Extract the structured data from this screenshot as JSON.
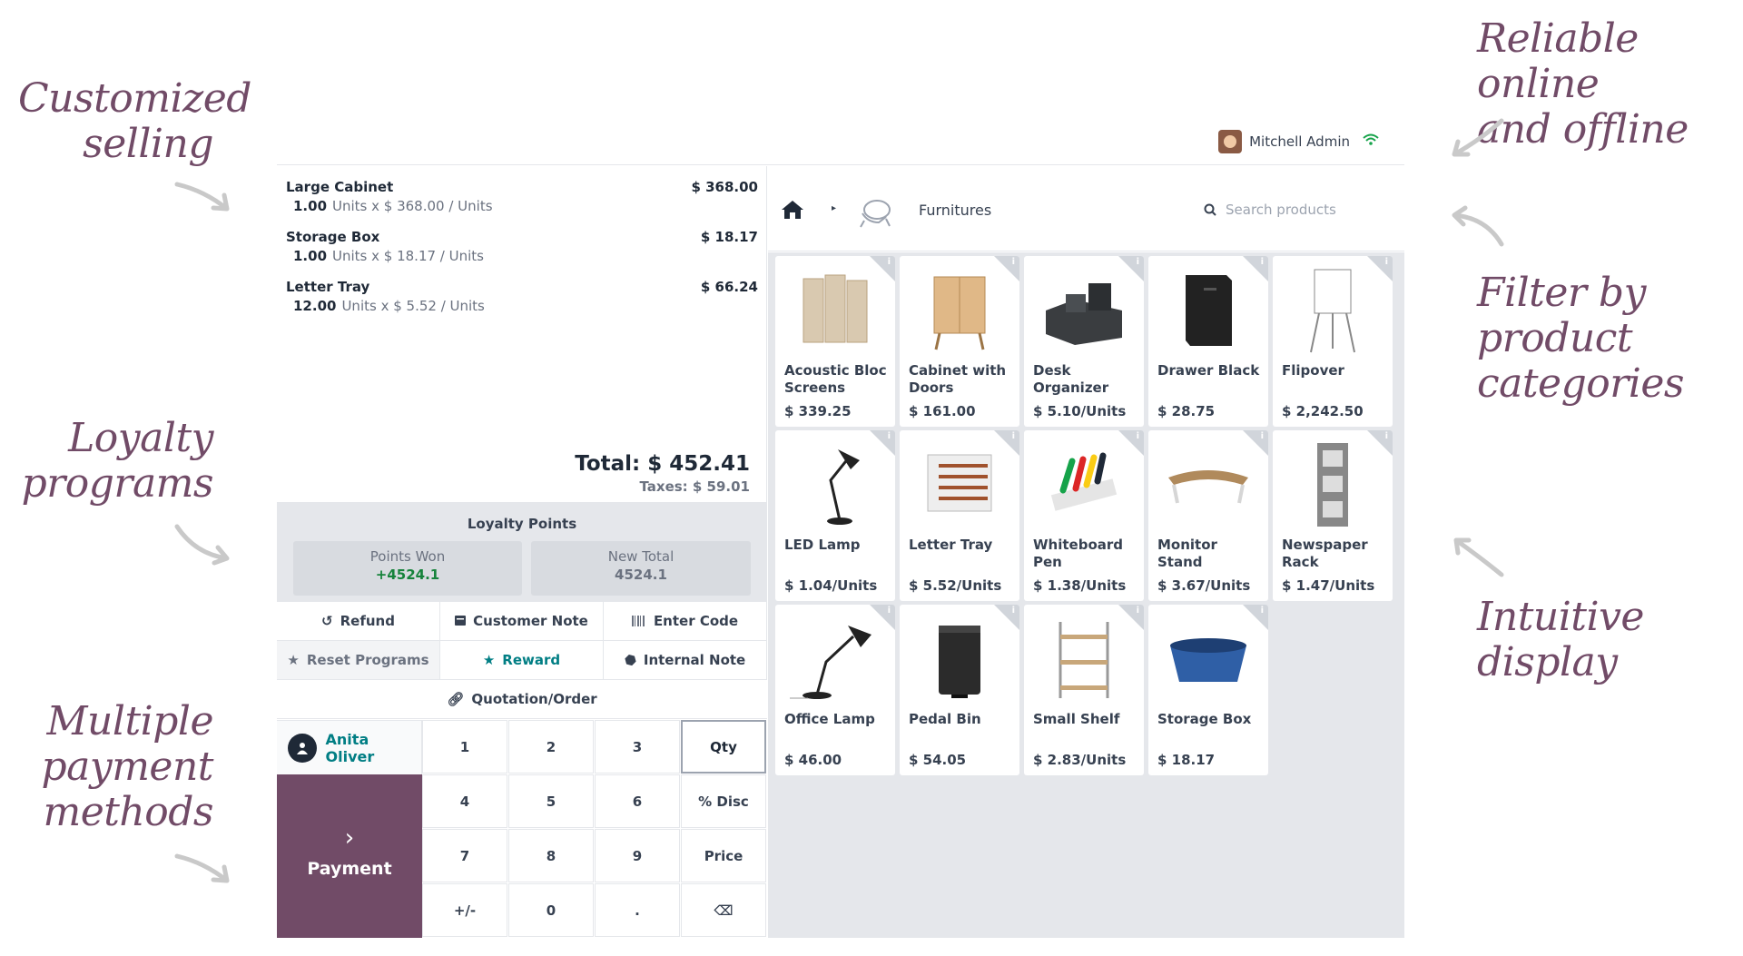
{
  "annotations": {
    "customized_selling": "Customized\nselling",
    "loyalty_programs": "Loyalty\nprograms",
    "multiple_payment": "Multiple\npayment\nmethods",
    "reliable": "Reliable online\nand offline",
    "filter": "Filter by\nproduct\ncategories",
    "intuitive": "Intuitive\ndisplay"
  },
  "topbar": {
    "user_name": "Mitchell Admin"
  },
  "order": {
    "lines": [
      {
        "name": "Large Cabinet",
        "qty": "1.00",
        "detail": "Units x $ 368.00 / Units",
        "price": "$ 368.00"
      },
      {
        "name": "Storage Box",
        "qty": "1.00",
        "detail": "Units x $ 18.17 / Units",
        "price": "$ 18.17"
      },
      {
        "name": "Letter Tray",
        "qty": "12.00",
        "detail": "Units x $ 5.52 / Units",
        "price": "$ 66.24"
      }
    ],
    "total": "Total: $ 452.41",
    "taxes": "Taxes: $ 59.01"
  },
  "loyalty": {
    "title": "Loyalty Points",
    "points_won_label": "Points Won",
    "points_won_value": "+4524.1",
    "new_total_label": "New Total",
    "new_total_value": "4524.1"
  },
  "controls": {
    "refund": "Refund",
    "customer_note": "Customer Note",
    "enter_code": "Enter Code",
    "reset_programs": "Reset Programs",
    "reward": "Reward",
    "internal_note": "Internal Note",
    "quotation": "Quotation/Order"
  },
  "customer": {
    "name": "Anita Oliver"
  },
  "payment": {
    "label": "Payment",
    "chevron": "›"
  },
  "numpad": {
    "keys": [
      "1",
      "2",
      "3",
      "Qty",
      "4",
      "5",
      "6",
      "% Disc",
      "7",
      "8",
      "9",
      "Price",
      "+/-",
      "0",
      ".",
      "⌫"
    ],
    "selected": "Qty"
  },
  "category": {
    "name": "Furnitures",
    "separator": "▸"
  },
  "search": {
    "placeholder": "Search products"
  },
  "products": [
    {
      "name": "Acoustic Bloc Screens",
      "price": "$ 339.25",
      "icon": "acoustic-screen-image"
    },
    {
      "name": "Cabinet with Doors",
      "price": "$ 161.00",
      "icon": "cabinet-image"
    },
    {
      "name": "Desk Organizer",
      "price": "$ 5.10/Units",
      "icon": "desk-organizer-image"
    },
    {
      "name": "Drawer Black",
      "price": "$ 28.75",
      "icon": "drawer-image"
    },
    {
      "name": "Flipover",
      "price": "$ 2,242.50",
      "icon": "flipover-image"
    },
    {
      "name": "LED Lamp",
      "price": "$ 1.04/Units",
      "icon": "led-lamp-image"
    },
    {
      "name": "Letter Tray",
      "price": "$ 5.52/Units",
      "icon": "letter-tray-image"
    },
    {
      "name": "Whiteboard Pen",
      "price": "$ 1.38/Units",
      "icon": "whiteboard-pen-image"
    },
    {
      "name": "Monitor Stand",
      "price": "$ 3.67/Units",
      "icon": "monitor-stand-image"
    },
    {
      "name": "Newspaper Rack",
      "price": "$ 1.47/Units",
      "icon": "newspaper-rack-image"
    },
    {
      "name": "Office Lamp",
      "price": "$ 46.00",
      "icon": "office-lamp-image"
    },
    {
      "name": "Pedal Bin",
      "price": "$ 54.05",
      "icon": "pedal-bin-image"
    },
    {
      "name": "Small Shelf",
      "price": "$ 2.83/Units",
      "icon": "small-shelf-image"
    },
    {
      "name": "Storage Box",
      "price": "$ 18.17",
      "icon": "storage-box-image"
    }
  ],
  "colors": {
    "brand": "#714b67",
    "accent": "#017e84",
    "positive": "#16833b",
    "panel": "#e5e7eb"
  }
}
